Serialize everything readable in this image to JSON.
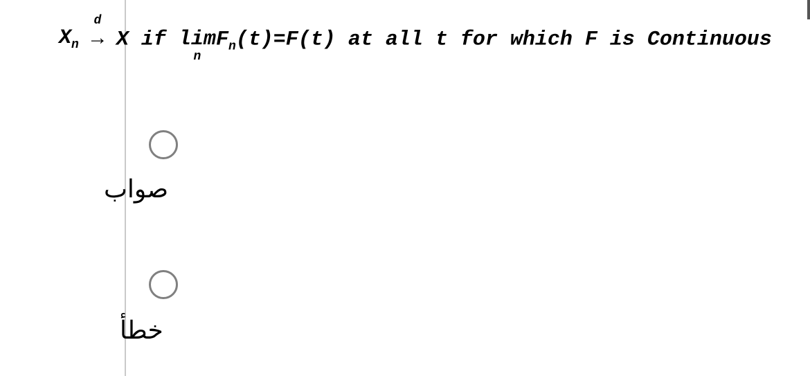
{
  "statement": {
    "Xn_base": "X",
    "Xn_sub": "n",
    "arrow_top": "d",
    "arrow_symbol": "→",
    "X_after": "X",
    "if_text": "if ",
    "lim_text": "lim",
    "lim_sub": "n",
    "Fn_base": "F",
    "Fn_sub": "n",
    "Fn_arg": "(t)",
    "equals": "=",
    "Ft": "F(t)",
    "tail": " at all t for which F is Continuous"
  },
  "options": {
    "true": "صواب",
    "false": "خطأ"
  }
}
